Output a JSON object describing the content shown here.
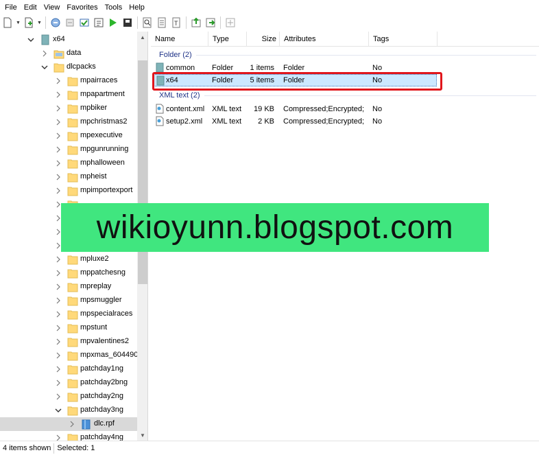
{
  "menu": [
    "File",
    "Edit",
    "View",
    "Favorites",
    "Tools",
    "Help"
  ],
  "toolbar_icons": [
    "new-document-icon",
    "new-file-icon",
    "open-icon",
    "import-icon",
    "check-icon",
    "rebuild-icon",
    "play-icon",
    "archive-icon",
    "search-icon",
    "text-icon",
    "format-icon",
    "export-icon",
    "extract-icon",
    "properties-icon"
  ],
  "tree": {
    "items": [
      {
        "label": "x64",
        "depth": 0,
        "expanded": true,
        "icon": "archive"
      },
      {
        "label": "data",
        "depth": 1,
        "expanded": false,
        "icon": "folder-special"
      },
      {
        "label": "dlcpacks",
        "depth": 1,
        "expanded": true,
        "icon": "folder"
      },
      {
        "label": "mpairraces",
        "depth": 2,
        "expanded": false,
        "icon": "folder"
      },
      {
        "label": "mpapartment",
        "depth": 2,
        "expanded": false,
        "icon": "folder"
      },
      {
        "label": "mpbiker",
        "depth": 2,
        "expanded": false,
        "icon": "folder"
      },
      {
        "label": "mpchristmas2",
        "depth": 2,
        "expanded": false,
        "icon": "folder"
      },
      {
        "label": "mpexecutive",
        "depth": 2,
        "expanded": false,
        "icon": "folder"
      },
      {
        "label": "mpgunrunning",
        "depth": 2,
        "expanded": false,
        "icon": "folder"
      },
      {
        "label": "mphalloween",
        "depth": 2,
        "expanded": false,
        "icon": "folder"
      },
      {
        "label": "mpheist",
        "depth": 2,
        "expanded": false,
        "icon": "folder"
      },
      {
        "label": "mpimportexport",
        "depth": 2,
        "expanded": false,
        "icon": "folder"
      },
      {
        "label": "",
        "depth": 2,
        "expanded": false,
        "icon": "folder"
      },
      {
        "label": "",
        "depth": 2,
        "expanded": false,
        "icon": "folder"
      },
      {
        "label": "",
        "depth": 2,
        "expanded": false,
        "icon": "folder"
      },
      {
        "label": "",
        "depth": 2,
        "expanded": false,
        "icon": "folder"
      },
      {
        "label": "mpluxe2",
        "depth": 2,
        "expanded": false,
        "icon": "folder"
      },
      {
        "label": "mppatchesng",
        "depth": 2,
        "expanded": false,
        "icon": "folder"
      },
      {
        "label": "mpreplay",
        "depth": 2,
        "expanded": false,
        "icon": "folder"
      },
      {
        "label": "mpsmuggler",
        "depth": 2,
        "expanded": false,
        "icon": "folder"
      },
      {
        "label": "mpspecialraces",
        "depth": 2,
        "expanded": false,
        "icon": "folder"
      },
      {
        "label": "mpstunt",
        "depth": 2,
        "expanded": false,
        "icon": "folder"
      },
      {
        "label": "mpvalentines2",
        "depth": 2,
        "expanded": false,
        "icon": "folder"
      },
      {
        "label": "mpxmas_604490",
        "depth": 2,
        "expanded": false,
        "icon": "folder"
      },
      {
        "label": "patchday1ng",
        "depth": 2,
        "expanded": false,
        "icon": "folder"
      },
      {
        "label": "patchday2bng",
        "depth": 2,
        "expanded": false,
        "icon": "folder"
      },
      {
        "label": "patchday2ng",
        "depth": 2,
        "expanded": false,
        "icon": "folder"
      },
      {
        "label": "patchday3ng",
        "depth": 2,
        "expanded": true,
        "icon": "folder"
      },
      {
        "label": "dlc.rpf",
        "depth": 3,
        "expanded": false,
        "icon": "rpf",
        "selected": true
      },
      {
        "label": "patchday4ng",
        "depth": 2,
        "expanded": false,
        "icon": "folder"
      }
    ]
  },
  "columns": [
    "Name",
    "Type",
    "Size",
    "Attributes",
    "Tags"
  ],
  "groups": [
    {
      "label": "Folder (2)",
      "rows": [
        {
          "name": "common",
          "type": "Folder",
          "size": "1 items",
          "attributes": "Folder",
          "tags": "No",
          "icon": "archive"
        },
        {
          "name": "x64",
          "type": "Folder",
          "size": "5 items",
          "attributes": "Folder",
          "tags": "No",
          "icon": "archive",
          "selected": true
        }
      ]
    },
    {
      "label": "XML text (2)",
      "rows": [
        {
          "name": "content.xml",
          "type": "XML text",
          "size": "19 KB",
          "attributes": "Compressed;Encrypted;",
          "tags": "No",
          "icon": "xml"
        },
        {
          "name": "setup2.xml",
          "type": "XML text",
          "size": "2 KB",
          "attributes": "Compressed;Encrypted;",
          "tags": "No",
          "icon": "xml"
        }
      ]
    }
  ],
  "watermark": "wikioyunn.blogspot.com",
  "status": {
    "items": "4 items shown",
    "selected": "Selected: 1"
  },
  "colors": {
    "folder": "#ffd97a",
    "archive": "#7fb3b8",
    "selection": "#cce8ff",
    "group_text": "#1e3287",
    "highlight": "#e0161c",
    "watermark_bg": "#40e67f"
  }
}
